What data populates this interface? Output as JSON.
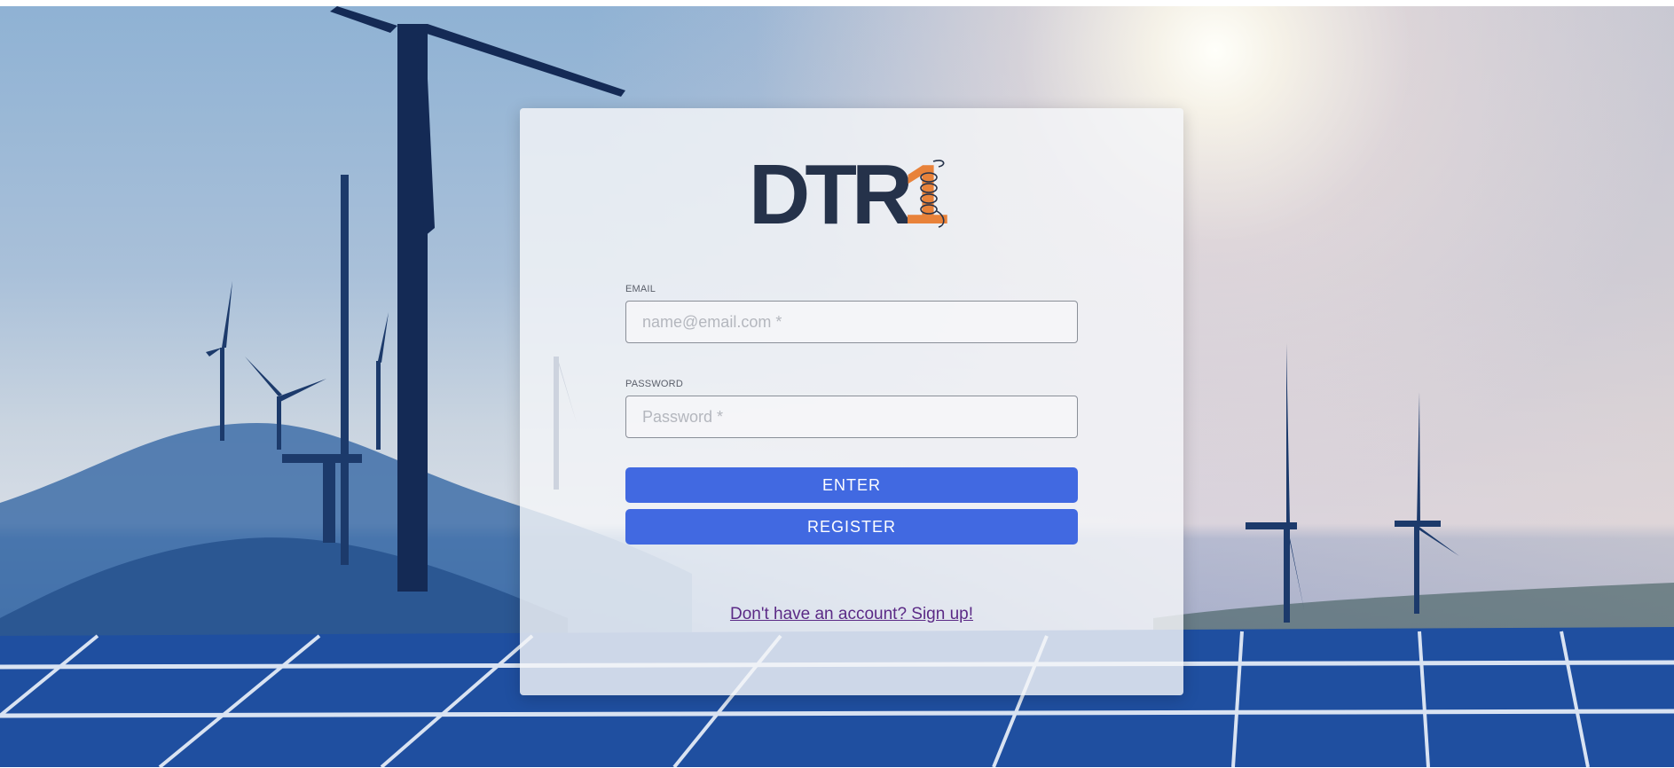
{
  "brand": {
    "logo_text": "DTR",
    "logo_digit": "1",
    "logo_dark_color": "#25324a",
    "logo_accent_color": "#e8823a"
  },
  "login_form": {
    "email_label": "EMAIL",
    "email_placeholder": "name@email.com *",
    "password_label": "PASSWORD",
    "password_placeholder": "Password *",
    "enter_button": "ENTER",
    "register_button": "REGISTER",
    "signup_link": "Don't have an account? Sign up!"
  },
  "colors": {
    "primary_button": "#4169e1",
    "link": "#5b2a86"
  }
}
